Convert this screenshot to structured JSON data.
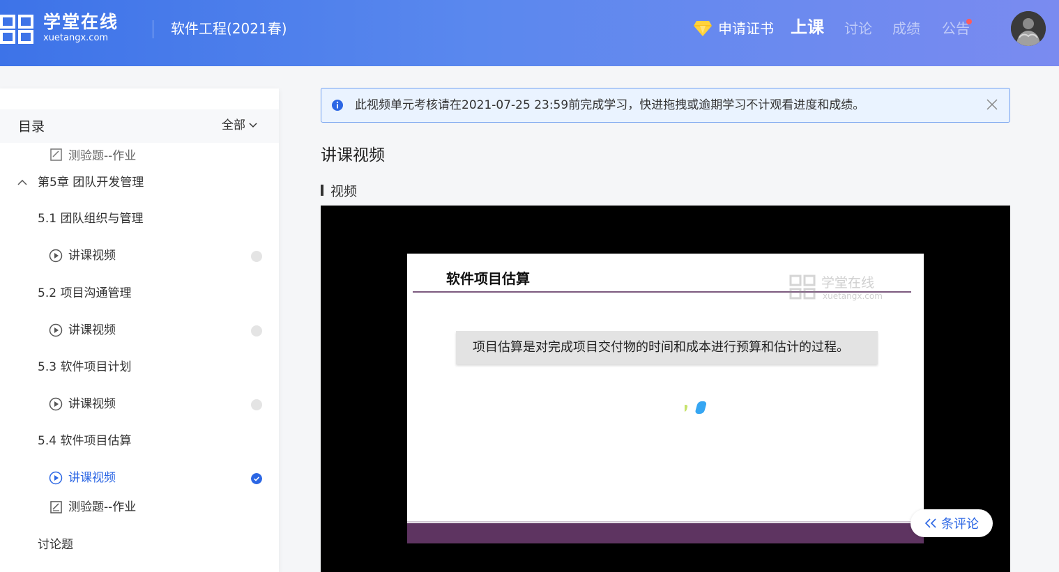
{
  "header": {
    "logo_cn": "学堂在线",
    "logo_en": "xuetangx.com",
    "course_title": "软件工程(2021春)",
    "nav": {
      "certificate": "申请证书",
      "class": "上课",
      "discussion": "讨论",
      "grades": "成绩",
      "notice": "公告"
    }
  },
  "sidebar": {
    "title": "目录",
    "filter": "全部",
    "items": [
      {
        "label": "测验题--作业",
        "icon": "quiz-icon"
      },
      {
        "label": "第5章 团队开发管理",
        "icon": "chevron-up-icon"
      },
      {
        "label": "5.1 团队组织与管理"
      },
      {
        "label": "讲课视频",
        "icon": "play-icon",
        "status": "incomplete"
      },
      {
        "label": "5.2 项目沟通管理"
      },
      {
        "label": "讲课视频",
        "icon": "play-icon",
        "status": "incomplete"
      },
      {
        "label": "5.3 软件项目计划"
      },
      {
        "label": "讲课视频",
        "icon": "play-icon",
        "status": "incomplete"
      },
      {
        "label": "5.4 软件项目估算"
      },
      {
        "label": "讲课视频",
        "icon": "play-icon",
        "status": "complete",
        "active": true
      },
      {
        "label": "测验题--作业",
        "icon": "quiz-icon"
      },
      {
        "label": "讨论题"
      }
    ]
  },
  "main": {
    "alert_text": "此视频单元考核请在2021-07-25 23:59前完成学习，快进拖拽或逾期学习不计观看进度和成绩。",
    "heading": "讲课视频",
    "section_label": "视频",
    "slide": {
      "title": "软件项目估算",
      "watermark_cn": "学堂在线",
      "watermark_en": "xuetangx.com",
      "body": "项目估算是对完成项目交付物的时间和成本进行预算和估计的过程。"
    },
    "comment_button": "条评论"
  },
  "colors": {
    "accent": "#2b66e4",
    "header_start": "#3d73e8",
    "header_end": "#7a8bf0",
    "slide_bar": "#5e3461"
  }
}
